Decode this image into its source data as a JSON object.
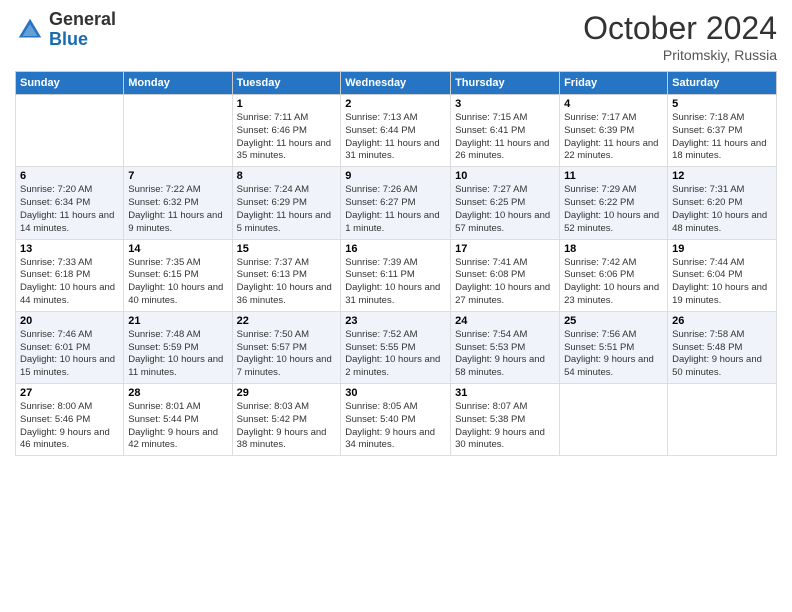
{
  "header": {
    "logo_general": "General",
    "logo_blue": "Blue",
    "month": "October 2024",
    "location": "Pritomskiy, Russia"
  },
  "weekdays": [
    "Sunday",
    "Monday",
    "Tuesday",
    "Wednesday",
    "Thursday",
    "Friday",
    "Saturday"
  ],
  "weeks": [
    [
      {
        "day": "",
        "sunrise": "",
        "sunset": "",
        "daylight": ""
      },
      {
        "day": "",
        "sunrise": "",
        "sunset": "",
        "daylight": ""
      },
      {
        "day": "1",
        "sunrise": "Sunrise: 7:11 AM",
        "sunset": "Sunset: 6:46 PM",
        "daylight": "Daylight: 11 hours and 35 minutes."
      },
      {
        "day": "2",
        "sunrise": "Sunrise: 7:13 AM",
        "sunset": "Sunset: 6:44 PM",
        "daylight": "Daylight: 11 hours and 31 minutes."
      },
      {
        "day": "3",
        "sunrise": "Sunrise: 7:15 AM",
        "sunset": "Sunset: 6:41 PM",
        "daylight": "Daylight: 11 hours and 26 minutes."
      },
      {
        "day": "4",
        "sunrise": "Sunrise: 7:17 AM",
        "sunset": "Sunset: 6:39 PM",
        "daylight": "Daylight: 11 hours and 22 minutes."
      },
      {
        "day": "5",
        "sunrise": "Sunrise: 7:18 AM",
        "sunset": "Sunset: 6:37 PM",
        "daylight": "Daylight: 11 hours and 18 minutes."
      }
    ],
    [
      {
        "day": "6",
        "sunrise": "Sunrise: 7:20 AM",
        "sunset": "Sunset: 6:34 PM",
        "daylight": "Daylight: 11 hours and 14 minutes."
      },
      {
        "day": "7",
        "sunrise": "Sunrise: 7:22 AM",
        "sunset": "Sunset: 6:32 PM",
        "daylight": "Daylight: 11 hours and 9 minutes."
      },
      {
        "day": "8",
        "sunrise": "Sunrise: 7:24 AM",
        "sunset": "Sunset: 6:29 PM",
        "daylight": "Daylight: 11 hours and 5 minutes."
      },
      {
        "day": "9",
        "sunrise": "Sunrise: 7:26 AM",
        "sunset": "Sunset: 6:27 PM",
        "daylight": "Daylight: 11 hours and 1 minute."
      },
      {
        "day": "10",
        "sunrise": "Sunrise: 7:27 AM",
        "sunset": "Sunset: 6:25 PM",
        "daylight": "Daylight: 10 hours and 57 minutes."
      },
      {
        "day": "11",
        "sunrise": "Sunrise: 7:29 AM",
        "sunset": "Sunset: 6:22 PM",
        "daylight": "Daylight: 10 hours and 52 minutes."
      },
      {
        "day": "12",
        "sunrise": "Sunrise: 7:31 AM",
        "sunset": "Sunset: 6:20 PM",
        "daylight": "Daylight: 10 hours and 48 minutes."
      }
    ],
    [
      {
        "day": "13",
        "sunrise": "Sunrise: 7:33 AM",
        "sunset": "Sunset: 6:18 PM",
        "daylight": "Daylight: 10 hours and 44 minutes."
      },
      {
        "day": "14",
        "sunrise": "Sunrise: 7:35 AM",
        "sunset": "Sunset: 6:15 PM",
        "daylight": "Daylight: 10 hours and 40 minutes."
      },
      {
        "day": "15",
        "sunrise": "Sunrise: 7:37 AM",
        "sunset": "Sunset: 6:13 PM",
        "daylight": "Daylight: 10 hours and 36 minutes."
      },
      {
        "day": "16",
        "sunrise": "Sunrise: 7:39 AM",
        "sunset": "Sunset: 6:11 PM",
        "daylight": "Daylight: 10 hours and 31 minutes."
      },
      {
        "day": "17",
        "sunrise": "Sunrise: 7:41 AM",
        "sunset": "Sunset: 6:08 PM",
        "daylight": "Daylight: 10 hours and 27 minutes."
      },
      {
        "day": "18",
        "sunrise": "Sunrise: 7:42 AM",
        "sunset": "Sunset: 6:06 PM",
        "daylight": "Daylight: 10 hours and 23 minutes."
      },
      {
        "day": "19",
        "sunrise": "Sunrise: 7:44 AM",
        "sunset": "Sunset: 6:04 PM",
        "daylight": "Daylight: 10 hours and 19 minutes."
      }
    ],
    [
      {
        "day": "20",
        "sunrise": "Sunrise: 7:46 AM",
        "sunset": "Sunset: 6:01 PM",
        "daylight": "Daylight: 10 hours and 15 minutes."
      },
      {
        "day": "21",
        "sunrise": "Sunrise: 7:48 AM",
        "sunset": "Sunset: 5:59 PM",
        "daylight": "Daylight: 10 hours and 11 minutes."
      },
      {
        "day": "22",
        "sunrise": "Sunrise: 7:50 AM",
        "sunset": "Sunset: 5:57 PM",
        "daylight": "Daylight: 10 hours and 7 minutes."
      },
      {
        "day": "23",
        "sunrise": "Sunrise: 7:52 AM",
        "sunset": "Sunset: 5:55 PM",
        "daylight": "Daylight: 10 hours and 2 minutes."
      },
      {
        "day": "24",
        "sunrise": "Sunrise: 7:54 AM",
        "sunset": "Sunset: 5:53 PM",
        "daylight": "Daylight: 9 hours and 58 minutes."
      },
      {
        "day": "25",
        "sunrise": "Sunrise: 7:56 AM",
        "sunset": "Sunset: 5:51 PM",
        "daylight": "Daylight: 9 hours and 54 minutes."
      },
      {
        "day": "26",
        "sunrise": "Sunrise: 7:58 AM",
        "sunset": "Sunset: 5:48 PM",
        "daylight": "Daylight: 9 hours and 50 minutes."
      }
    ],
    [
      {
        "day": "27",
        "sunrise": "Sunrise: 8:00 AM",
        "sunset": "Sunset: 5:46 PM",
        "daylight": "Daylight: 9 hours and 46 minutes."
      },
      {
        "day": "28",
        "sunrise": "Sunrise: 8:01 AM",
        "sunset": "Sunset: 5:44 PM",
        "daylight": "Daylight: 9 hours and 42 minutes."
      },
      {
        "day": "29",
        "sunrise": "Sunrise: 8:03 AM",
        "sunset": "Sunset: 5:42 PM",
        "daylight": "Daylight: 9 hours and 38 minutes."
      },
      {
        "day": "30",
        "sunrise": "Sunrise: 8:05 AM",
        "sunset": "Sunset: 5:40 PM",
        "daylight": "Daylight: 9 hours and 34 minutes."
      },
      {
        "day": "31",
        "sunrise": "Sunrise: 8:07 AM",
        "sunset": "Sunset: 5:38 PM",
        "daylight": "Daylight: 9 hours and 30 minutes."
      },
      {
        "day": "",
        "sunrise": "",
        "sunset": "",
        "daylight": ""
      },
      {
        "day": "",
        "sunrise": "",
        "sunset": "",
        "daylight": ""
      }
    ]
  ]
}
